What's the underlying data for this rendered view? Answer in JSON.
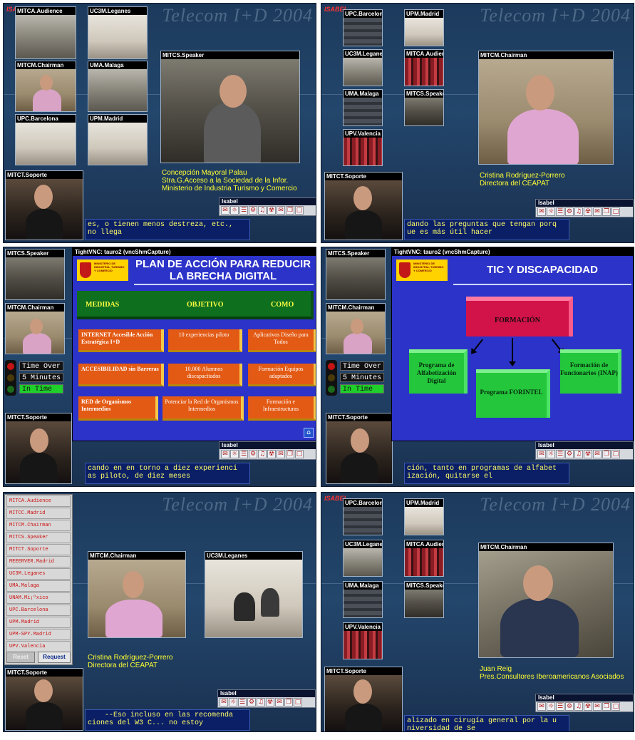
{
  "brand": "ISABEL",
  "watermark": "Telecom I+D 2004",
  "toolbar_title": "Isabel",
  "toolbar_icons": [
    "✉",
    "☼",
    "☰",
    "⚙",
    "♫",
    "☢",
    "✉",
    "❐",
    "□"
  ],
  "panels": {
    "p1": {
      "videos": {
        "audience": "MITCA.Audience",
        "leganes": "UC3M.Leganes",
        "chairman": "MITCM.Chairman",
        "malaga": "UMA.Malaga",
        "barcelona": "UPC.Barcelona",
        "madrid": "UPM.Madrid",
        "speaker": "MITCS.Speaker",
        "soporte": "MITCT.Soporte"
      },
      "caption": [
        "Concepción Mayoral Palau",
        "Stra.G.Acceso a la Sociedad de la Infor.",
        "Ministerio de Industria Turismo y Comercio"
      ],
      "subtitle": "es, o tienen menos destreza, etc.,\nno llega"
    },
    "p2": {
      "videos": {
        "barcelona": "UPC.Barcelona",
        "madrid": "UPM.Madrid",
        "leganes": "UC3M.Leganes",
        "audience": "MITCA.Audience",
        "malaga": "UMA.Malaga",
        "speaker": "MITCS.Speaker",
        "valencia": "UPV.Valencia",
        "chairman": "MITCM.Chairman",
        "soporte": "MITCT.Soporte"
      },
      "caption": [
        "Cristina Rodríguez-Porrero",
        "Directora del CEAPAT"
      ],
      "subtitle": "dando las preguntas que tengan porq\nue es más útil hacer"
    },
    "p3": {
      "videos": {
        "speaker": "MITCS.Speaker",
        "chairman": "MITCM.Chairman",
        "soporte": "MITCT.Soporte"
      },
      "timer": [
        "Time Over",
        "5 Minutes",
        "In Time"
      ],
      "vnc_title": "TightVNC: tauro2 (vncShmCapture)",
      "slide": {
        "logo_text": "MINISTERIO DE INDUSTRIA, TURISMO Y COMERCIO",
        "title": "PLAN DE ACCIÓN PARA REDUCIR LA BRECHA DIGITAL",
        "headers": [
          "MEDIDAS",
          "OBJETIVO",
          "COMO"
        ],
        "rows": [
          [
            "INTERNET Accesible Acción Estratégica I+D",
            "10 experiencias piloto",
            "Aplicativos Diseño para Todos"
          ],
          [
            "ACCESIBILIDAD sin Barreras",
            "10.000 Alumnos discapacitados",
            "Formación Equipos adaptados"
          ],
          [
            "RED de Organismos Intermedios",
            "Potenciar la Red de Organismos Intermedios",
            "Formación e Infraestructuras"
          ]
        ]
      },
      "subtitle": "cando en en torno a diez experienci\nas piloto, de diez meses"
    },
    "p4": {
      "videos": {
        "speaker": "MITCS.Speaker",
        "chairman": "MITCM.Chairman",
        "soporte": "MITCT.Soporte"
      },
      "timer": [
        "Time Over",
        "5 Minutes",
        "In Time"
      ],
      "vnc_title": "TightVNC: tauro2 (vncShmCapture)",
      "slide": {
        "logo_text": "MINISTERIO DE INDUSTRIA, TURISMO Y COMERCIO",
        "title": "TIC Y DISCAPACIDAD",
        "root": "FORMACIÓN",
        "children": [
          "Programa de Alfabetización Digital",
          "Programa FORINTEL",
          "Formación de Funcionarios (INAP)"
        ]
      },
      "subtitle": "ción, tanto en programas de alfabet\nización, quitarse el"
    },
    "p5": {
      "menu": [
        "MITCA.Audience",
        "MITCC.Madrid",
        "MITCM.Chairman",
        "MITCS.Speaker",
        "MITCT.Soporte",
        "MEEERVER.Madrid",
        "UC3M.Leganes",
        "UMA.Malaga",
        "UNAM.Mi¡ºxico",
        "UPC.Barcelona",
        "UPM.Madrid",
        "UPM-SPY.Madrid",
        "UPV.Valencia"
      ],
      "menu_buttons": [
        "Reset",
        "Request"
      ],
      "videos": {
        "chairman": "MITCM.Chairman",
        "leganes": "UC3M.Leganes",
        "soporte": "MITCT.Soporte"
      },
      "caption": [
        "Cristina Rodríguez-Porrero",
        "Directora del CEAPAT"
      ],
      "subtitle": "    --Eso incluso en las recomenda\nciones del W3 C... no estoy"
    },
    "p6": {
      "videos": {
        "barcelona": "UPC.Barcelona",
        "madrid": "UPM.Madrid",
        "leganes": "UC3M.Leganes",
        "audience": "MITCA.Audience",
        "malaga": "UMA.Malaga",
        "speaker": "MITCS.Speaker",
        "valencia": "UPV.Valencia",
        "chairman": "MITCM.Chairman",
        "soporte": "MITCT.Soporte"
      },
      "caption": [
        "Juan Reig",
        "Pres.Consultores Iberoamericanos Asociados"
      ],
      "subtitle": "alizado en cirugía general por la u\nniversidad de Se"
    }
  }
}
